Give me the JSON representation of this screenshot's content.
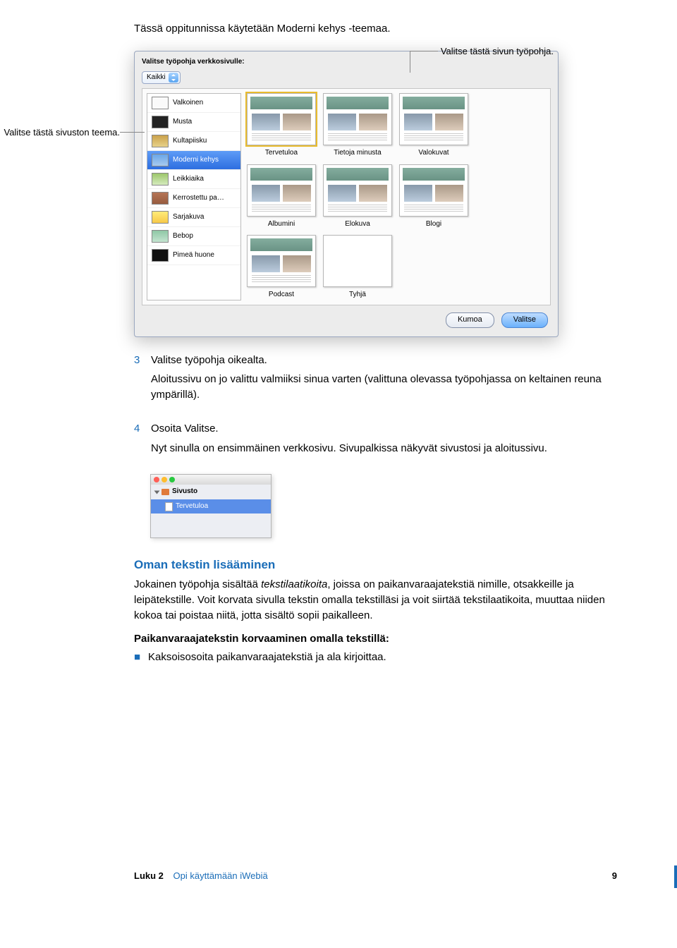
{
  "intro": "Tässä oppitunnissa käytetään Moderni kehys -teemaa.",
  "callouts": {
    "left": "Valitse tästä sivuston teema.",
    "top": "Valitse tästä sivun työpohja."
  },
  "dialog": {
    "prompt": "Valitse työpohja verkkosivulle:",
    "selectValue": "Kaikki",
    "themes": [
      "Valkoinen",
      "Musta",
      "Kultapiisku",
      "Moderni kehys",
      "Leikkiaika",
      "Kerrostettu pa…",
      "Sarjakuva",
      "Bebop",
      "Pimeä huone"
    ],
    "templates": [
      "Tervetuloa",
      "Tietoja minusta",
      "Valokuvat",
      "",
      "Albumini",
      "Elokuva",
      "Blogi",
      "",
      "Podcast",
      "Tyhjä",
      "",
      ""
    ],
    "buttons": {
      "cancel": "Kumoa",
      "choose": "Valitse"
    }
  },
  "steps": {
    "s3": "Valitse työpohja oikealta.",
    "s3b": "Aloitussivu on jo valittu valmiiksi sinua varten (valittuna olevassa työpohjassa on keltainen reuna ympärillä).",
    "s4": "Osoita Valitse.",
    "s4b": "Nyt sinulla on ensimmäinen verkkosivu. Sivupalkissa näkyvät sivustosi ja aloitussivu."
  },
  "mini": {
    "site": "Sivusto",
    "welcome": "Tervetuloa"
  },
  "addText": {
    "heading": "Oman tekstin lisääminen",
    "p1a": "Jokainen työpohja sisältää ",
    "p1i": "tekstilaatikoita",
    "p1b": ", joissa on paikanvaraajatekstiä nimille, otsakkeille ja leipätekstille. Voit korvata sivulla tekstin omalla tekstilläsi ja voit siirtää tekstilaatikoita, muuttaa niiden kokoa tai poistaa niitä, jotta sisältö sopii paikalleen.",
    "replaceHead": "Paikanvaraajatekstin korvaaminen omalla tekstillä:",
    "bullet": "Kaksoisosoita paikanvaraajatekstiä ja ala kirjoittaa."
  },
  "footer": {
    "chapter": "Luku 2",
    "title": "Opi käyttämään iWebiä",
    "page": "9"
  }
}
